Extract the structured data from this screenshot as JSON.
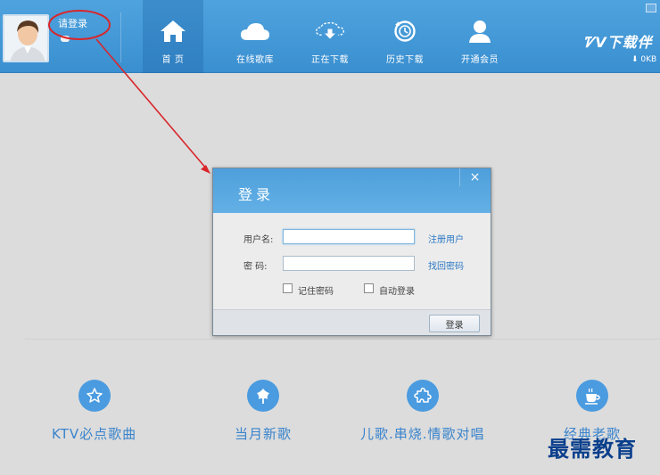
{
  "header": {
    "login_prompt": "请登录",
    "nav": [
      {
        "label": "首 页",
        "icon": "home-icon",
        "active": true
      },
      {
        "label": "在线歌库",
        "icon": "cloud-icon",
        "active": false
      },
      {
        "label": "正在下载",
        "icon": "cloud-download-icon",
        "active": false
      },
      {
        "label": "历史下载",
        "icon": "history-icon",
        "active": false
      },
      {
        "label": "开通会员",
        "icon": "vip-user-icon",
        "active": false
      }
    ],
    "logo": "下载伴",
    "download_speed": "0KB"
  },
  "login_dialog": {
    "title": "登录",
    "username_label": "用户名:",
    "username_value": "",
    "password_label": "密 码:",
    "password_value": "",
    "register_link": "注册用户",
    "recover_link": "找回密码",
    "remember_password_label": "记住密码",
    "remember_password_checked": false,
    "auto_login_label": "自动登录",
    "auto_login_checked": false,
    "submit_label": "登录",
    "close_symbol": "×"
  },
  "categories": [
    {
      "label": "KTV必点歌曲",
      "icon": "star-icon"
    },
    {
      "label": "当月新歌",
      "icon": "leaf-icon"
    },
    {
      "label": "儿歌.串烧.情歌对唱",
      "icon": "puzzle-icon"
    },
    {
      "label": "经典老歌",
      "icon": "coffee-cup-icon"
    }
  ],
  "watermark": "最需教育",
  "colors": {
    "header": "#3a8fd0",
    "accent": "#4a9be0",
    "annotation": "#d9262b",
    "link": "#2c78c4"
  }
}
